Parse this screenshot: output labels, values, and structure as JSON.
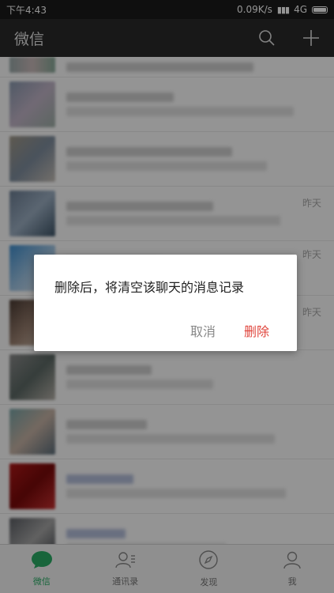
{
  "status_bar": {
    "time": "下午4:43",
    "net_speed": "0.09K/s",
    "network": "4G"
  },
  "header": {
    "title": "微信"
  },
  "chats": [
    {
      "time": ""
    },
    {
      "time": ""
    },
    {
      "time": ""
    },
    {
      "time": "昨天"
    },
    {
      "time": "昨天"
    },
    {
      "time": ""
    },
    {
      "time": ""
    },
    {
      "time": ""
    },
    {
      "time": ""
    }
  ],
  "dialog": {
    "message": "删除后，将清空该聊天的消息记录",
    "cancel_label": "取消",
    "delete_label": "删除",
    "delete_color": "#e0453c"
  },
  "tabs": [
    {
      "label": "微信",
      "icon": "chat-bubble-icon",
      "active": true
    },
    {
      "label": "通讯录",
      "icon": "contacts-icon",
      "active": false
    },
    {
      "label": "发现",
      "icon": "compass-icon",
      "active": false
    },
    {
      "label": "我",
      "icon": "person-icon",
      "active": false
    }
  ],
  "colors": {
    "accent": "#2aae67",
    "header_bg": "#2a2a2a"
  }
}
